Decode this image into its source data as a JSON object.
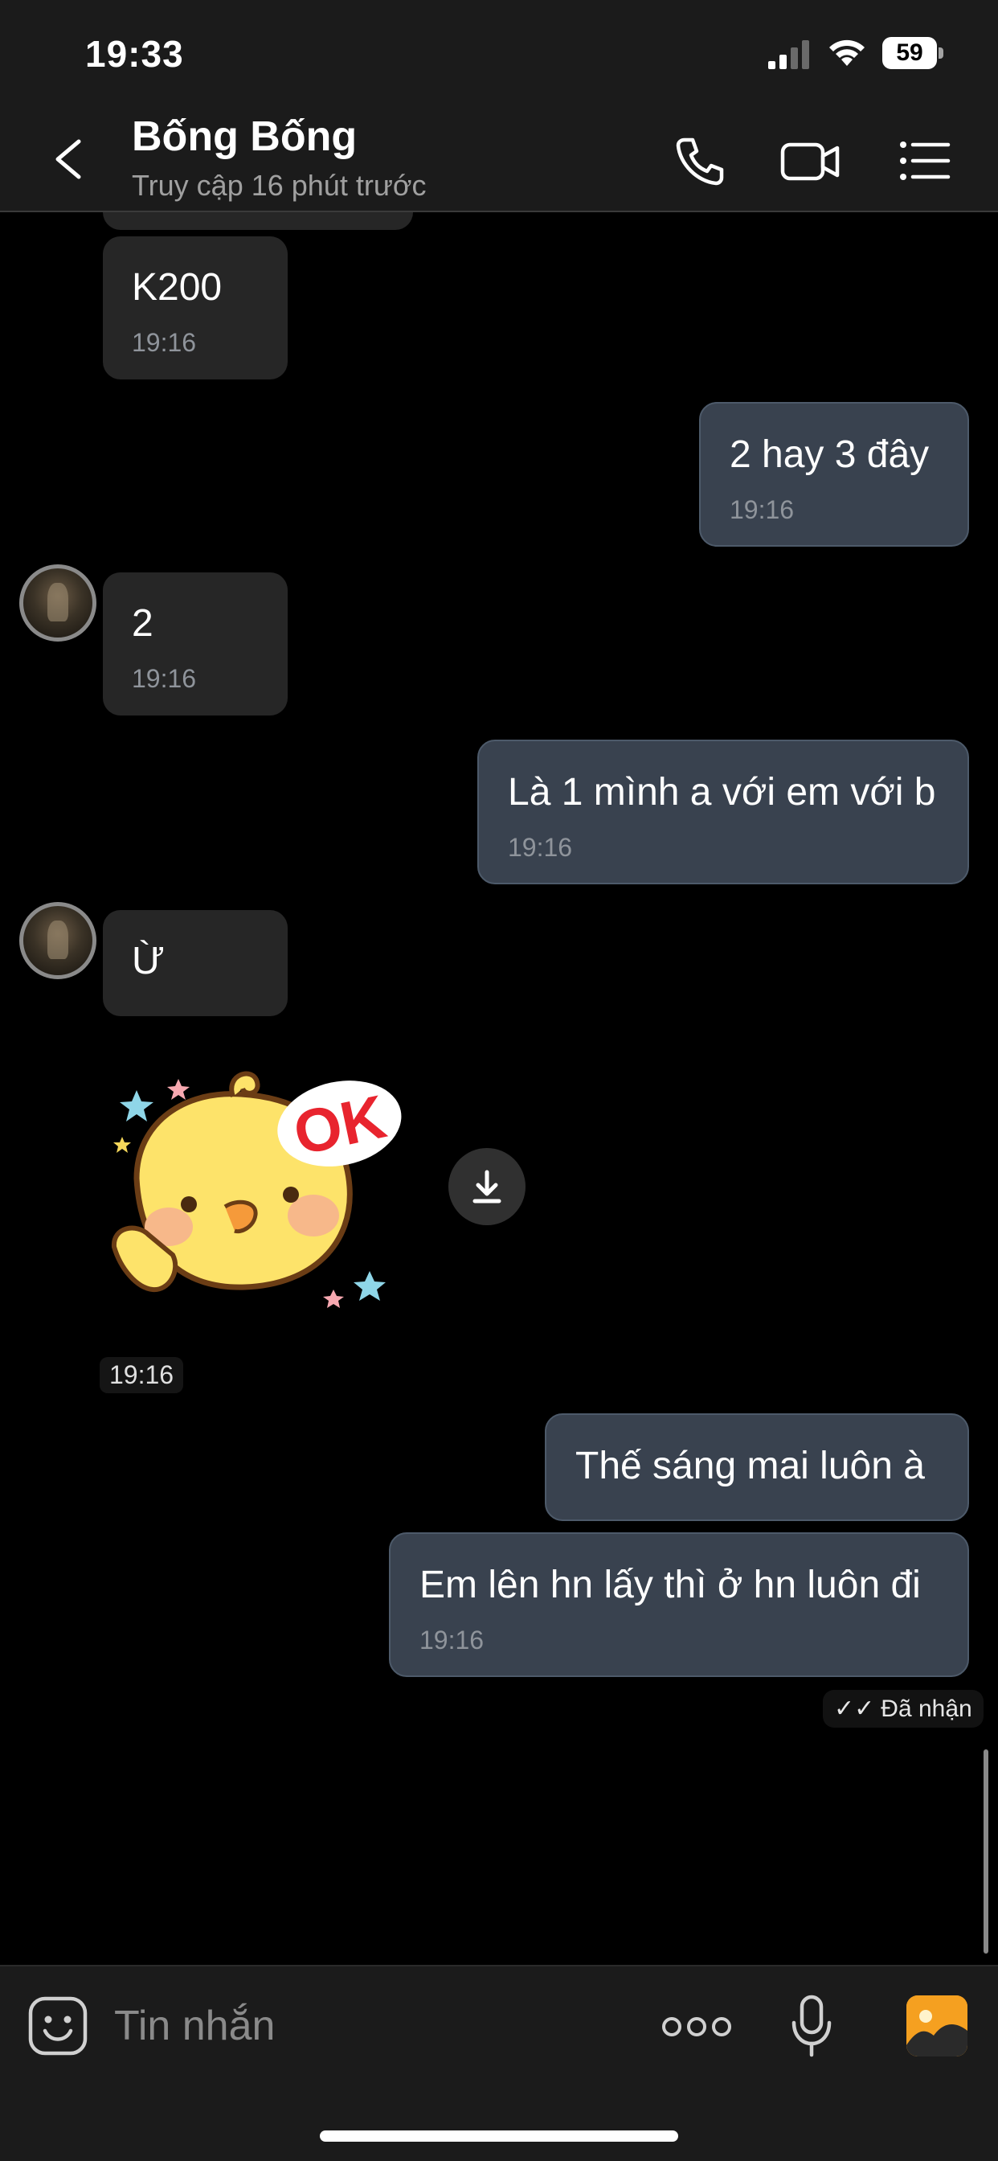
{
  "status_bar": {
    "time": "19:33",
    "battery": "59"
  },
  "header": {
    "contact_name": "Bống Bống",
    "contact_status": "Truy cập 16 phút trước",
    "icons": [
      "back-arrow-icon",
      "phone-icon",
      "video-camera-icon",
      "menu-list-icon"
    ]
  },
  "messages": [
    {
      "direction": "in",
      "text": "K200",
      "time": "19:16"
    },
    {
      "direction": "out",
      "text": "2 hay 3 đây",
      "time": "19:16"
    },
    {
      "direction": "in",
      "text": "2",
      "time": "19:16"
    },
    {
      "direction": "out",
      "text": "Là 1 mình a với em với b",
      "time": "19:16"
    },
    {
      "direction": "in",
      "text": "Ừ",
      "time": ""
    },
    {
      "direction": "in",
      "type": "sticker",
      "sticker_text": "OK",
      "time": "19:16"
    },
    {
      "direction": "out",
      "text": "Thế sáng mai luôn à",
      "time": ""
    },
    {
      "direction": "out",
      "text": "Em lên hn lấy thì ở hn luôn đi",
      "time": "19:16"
    }
  ],
  "read_receipt": "Đã nhận",
  "composer": {
    "placeholder": "Tin nhắn",
    "icons": [
      "emoji-icon",
      "more-dots-icon",
      "microphone-icon",
      "gallery-icon"
    ]
  },
  "colors": {
    "incoming_bubble": "#262626",
    "outgoing_bubble": "#39424f",
    "bar_background": "#1b1b1b",
    "accent": "#f5a020"
  }
}
